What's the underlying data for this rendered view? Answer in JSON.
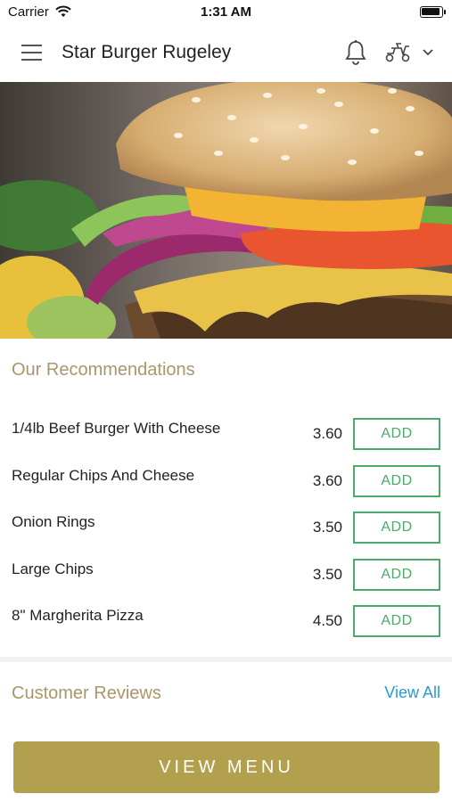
{
  "status_bar": {
    "carrier": "Carrier",
    "time": "1:31 AM"
  },
  "header": {
    "title": "Star Burger Rugeley",
    "icons": [
      "menu-icon",
      "bell-icon",
      "scooter-icon",
      "chevron-down-icon"
    ]
  },
  "hero": {
    "image": "burger-photo"
  },
  "recommendations": {
    "title": "Our Recommendations",
    "add_label": "ADD",
    "items": [
      {
        "name": "1/4lb Beef Burger With Cheese",
        "price": "3.60"
      },
      {
        "name": "Regular Chips And Cheese",
        "price": "3.60"
      },
      {
        "name": "Onion Rings",
        "price": "3.50"
      },
      {
        "name": "Large Chips",
        "price": "3.50"
      },
      {
        "name": "8\" Margherita Pizza",
        "price": "4.50"
      }
    ]
  },
  "reviews": {
    "title": "Customer Reviews",
    "view_all": "View All"
  },
  "footer": {
    "view_menu": "VIEW MENU"
  },
  "colors": {
    "accent_gold": "#b3a04e",
    "section_title": "#a8976a",
    "add_green": "#4caa6a",
    "link_blue": "#2b9bd6"
  }
}
